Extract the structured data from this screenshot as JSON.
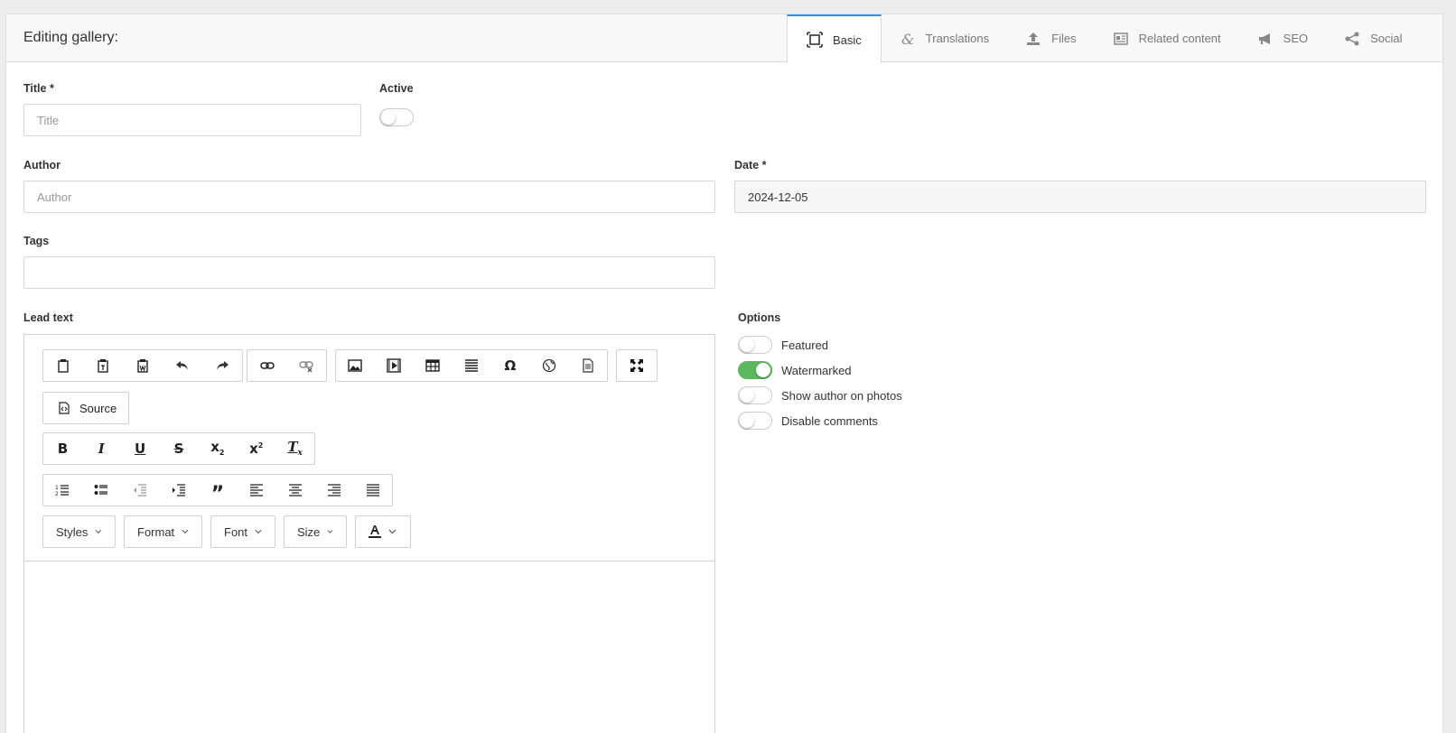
{
  "header": {
    "title": "Editing gallery:"
  },
  "tabs": [
    {
      "label": "Basic",
      "icon": "basic-icon",
      "active": true
    },
    {
      "label": "Translations",
      "icon": "ampersand-icon"
    },
    {
      "label": "Files",
      "icon": "upload-icon"
    },
    {
      "label": "Related content",
      "icon": "newspaper-icon"
    },
    {
      "label": "SEO",
      "icon": "megaphone-icon"
    },
    {
      "label": "Social",
      "icon": "share-icon"
    }
  ],
  "form": {
    "title_label": "Title *",
    "title_placeholder": "Title",
    "active_label": "Active",
    "author_label": "Author",
    "author_placeholder": "Author",
    "date_label": "Date *",
    "date_value": "2024-12-05",
    "tags_label": "Tags",
    "lead_label": "Lead text",
    "options_label": "Options"
  },
  "options": [
    {
      "label": "Featured",
      "on": false
    },
    {
      "label": "Watermarked",
      "on": true
    },
    {
      "label": "Show author on photos",
      "on": false
    },
    {
      "label": "Disable comments",
      "on": false
    }
  ],
  "editor": {
    "source_label": "Source",
    "combos": [
      "Styles",
      "Format",
      "Font",
      "Size"
    ],
    "accent_color": "#5cb85c",
    "active_tab_color": "#2f8ff0"
  }
}
